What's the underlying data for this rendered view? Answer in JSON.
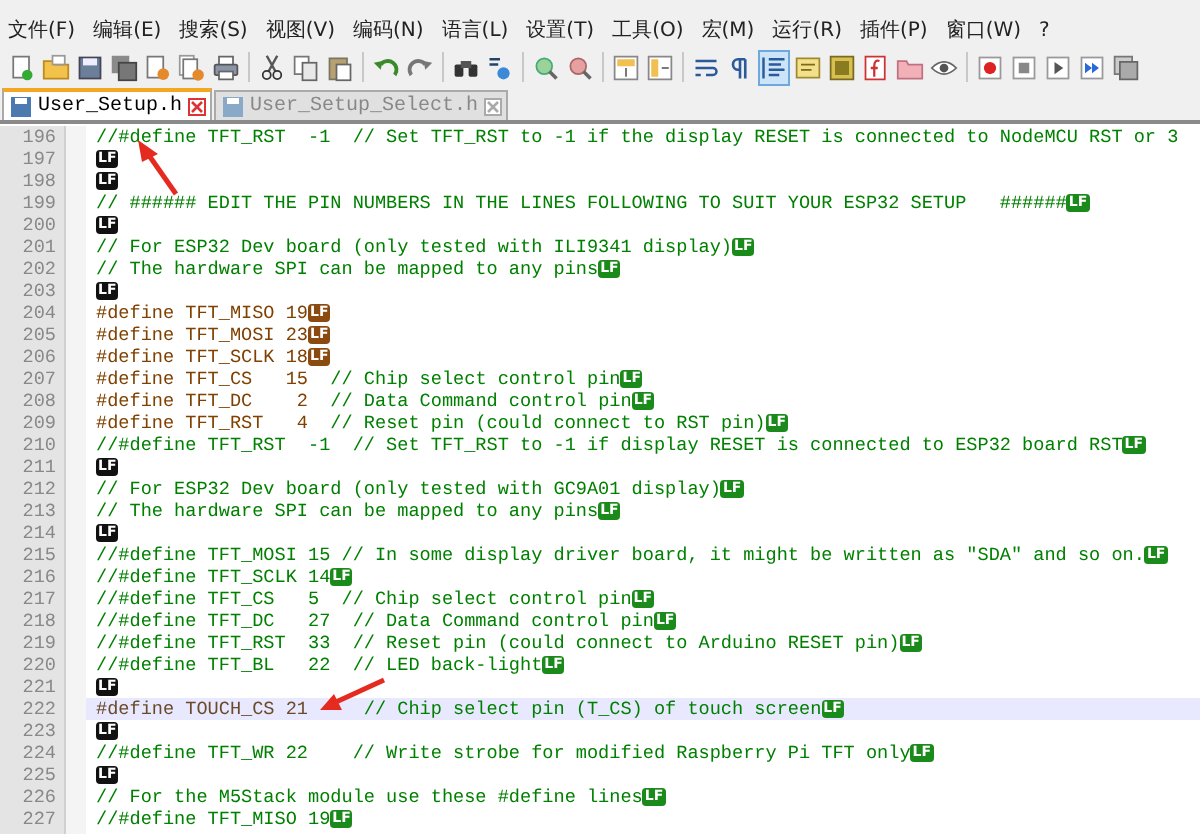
{
  "menu": [
    "文件(F)",
    "编辑(E)",
    "搜索(S)",
    "视图(V)",
    "编码(N)",
    "语言(L)",
    "设置(T)",
    "工具(O)",
    "宏(M)",
    "运行(R)",
    "插件(P)",
    "窗口(W)",
    "?"
  ],
  "toolbar": [
    {
      "kind": "new",
      "pressed": false
    },
    {
      "kind": "open",
      "pressed": false
    },
    {
      "kind": "save",
      "pressed": false
    },
    {
      "kind": "save-all",
      "pressed": false
    },
    {
      "kind": "close",
      "pressed": false
    },
    {
      "kind": "close-all",
      "pressed": false
    },
    {
      "kind": "print",
      "pressed": false
    },
    {
      "kind": "separator"
    },
    {
      "kind": "cut",
      "pressed": false
    },
    {
      "kind": "copy",
      "pressed": false
    },
    {
      "kind": "paste",
      "pressed": false
    },
    {
      "kind": "separator"
    },
    {
      "kind": "undo",
      "pressed": false
    },
    {
      "kind": "redo",
      "pressed": false
    },
    {
      "kind": "separator"
    },
    {
      "kind": "find",
      "pressed": false
    },
    {
      "kind": "replace",
      "pressed": false
    },
    {
      "kind": "separator"
    },
    {
      "kind": "zoom-in",
      "pressed": false
    },
    {
      "kind": "zoom-out",
      "pressed": false
    },
    {
      "kind": "separator"
    },
    {
      "kind": "sync-v",
      "pressed": false
    },
    {
      "kind": "sync-h",
      "pressed": false
    },
    {
      "kind": "separator"
    },
    {
      "kind": "wrap",
      "pressed": false
    },
    {
      "kind": "pilcrow",
      "pressed": false
    },
    {
      "kind": "indent",
      "pressed": true
    },
    {
      "kind": "udl",
      "pressed": false
    },
    {
      "kind": "docmap",
      "pressed": false
    },
    {
      "kind": "function",
      "pressed": false
    },
    {
      "kind": "folder",
      "pressed": false
    },
    {
      "kind": "eye",
      "pressed": false
    },
    {
      "kind": "separator"
    },
    {
      "kind": "record",
      "pressed": false
    },
    {
      "kind": "stop",
      "pressed": false
    },
    {
      "kind": "play",
      "pressed": false
    },
    {
      "kind": "play-multi",
      "pressed": false
    },
    {
      "kind": "save-macro",
      "pressed": false
    }
  ],
  "tabs": [
    {
      "label": "User_Setup.h",
      "selected": true
    },
    {
      "label": "User_Setup_Select.h",
      "selected": false
    }
  ],
  "lines": [
    {
      "number": "196",
      "kind": "comment",
      "text": "//#define TFT_RST  -1  // Set TFT_RST to -1 if the display RESET is connected to NodeMCU RST or 3",
      "current": false
    },
    {
      "number": "197",
      "kind": "blank",
      "eol": "LF",
      "current": false
    },
    {
      "number": "198",
      "kind": "blank",
      "eol": "LF",
      "current": false
    },
    {
      "number": "199",
      "kind": "comment",
      "text": "// ###### EDIT THE PIN NUMBERS IN THE LINES FOLLOWING TO SUIT YOUR ESP32 SETUP   ######",
      "eol": "LF",
      "current": false
    },
    {
      "number": "200",
      "kind": "blank",
      "eol": "LF",
      "current": false
    },
    {
      "number": "201",
      "kind": "comment",
      "text": "// For ESP32 Dev board (only tested with ILI9341 display)",
      "eol": "LF",
      "current": false
    },
    {
      "number": "202",
      "kind": "comment",
      "text": "// The hardware SPI can be mapped to any pins",
      "eol": "LF",
      "current": false
    },
    {
      "number": "203",
      "kind": "blank",
      "eol": "LF",
      "current": false
    },
    {
      "number": "204",
      "kind": "directive",
      "code": "#define TFT_MISO 19",
      "eol": "LF",
      "current": false
    },
    {
      "number": "205",
      "kind": "directive",
      "code": "#define TFT_MOSI 23",
      "eol": "LF",
      "current": false
    },
    {
      "number": "206",
      "kind": "directive",
      "code": "#define TFT_SCLK 18",
      "eol": "LF",
      "current": false
    },
    {
      "number": "207",
      "kind": "directive",
      "code": "#define TFT_CS   15  ",
      "comment": "// Chip select control pin",
      "eol": "LF",
      "current": false
    },
    {
      "number": "208",
      "kind": "directive",
      "code": "#define TFT_DC    2  ",
      "comment": "// Data Command control pin",
      "eol": "LF",
      "current": false
    },
    {
      "number": "209",
      "kind": "directive",
      "code": "#define TFT_RST   4  ",
      "comment": "// Reset pin (could connect to RST pin)",
      "eol": "LF",
      "current": false
    },
    {
      "number": "210",
      "kind": "comment",
      "text": "//#define TFT_RST  -1  // Set TFT_RST to -1 if display RESET is connected to ESP32 board RST",
      "eol": "LF",
      "current": false
    },
    {
      "number": "211",
      "kind": "blank",
      "eol": "LF",
      "current": false
    },
    {
      "number": "212",
      "kind": "comment",
      "text": "// For ESP32 Dev board (only tested with GC9A01 display)",
      "eol": "LF",
      "current": false
    },
    {
      "number": "213",
      "kind": "comment",
      "text": "// The hardware SPI can be mapped to any pins",
      "eol": "LF",
      "current": false
    },
    {
      "number": "214",
      "kind": "blank",
      "eol": "LF",
      "current": false
    },
    {
      "number": "215",
      "kind": "comment",
      "text": "//#define TFT_MOSI 15 // In some display driver board, it might be written as \"SDA\" and so on.",
      "eol": "LF",
      "current": false
    },
    {
      "number": "216",
      "kind": "comment",
      "text": "//#define TFT_SCLK 14",
      "eol": "LF",
      "current": false
    },
    {
      "number": "217",
      "kind": "comment",
      "text": "//#define TFT_CS   5  // Chip select control pin",
      "eol": "LF",
      "current": false
    },
    {
      "number": "218",
      "kind": "comment",
      "text": "//#define TFT_DC   27  // Data Command control pin",
      "eol": "LF",
      "current": false
    },
    {
      "number": "219",
      "kind": "comment",
      "text": "//#define TFT_RST  33  // Reset pin (could connect to Arduino RESET pin)",
      "eol": "LF",
      "current": false
    },
    {
      "number": "220",
      "kind": "comment",
      "text": "//#define TFT_BL   22  // LED back-light",
      "eol": "LF",
      "current": false
    },
    {
      "number": "221",
      "kind": "blank",
      "eol": "LF",
      "current": false
    },
    {
      "number": "222",
      "kind": "directive",
      "code": "#define TOUCH_CS 21     ",
      "comment": "// Chip select pin (T_CS) of touch screen",
      "eol": "LF",
      "current": true
    },
    {
      "number": "223",
      "kind": "blank",
      "eol": "LF",
      "current": false
    },
    {
      "number": "224",
      "kind": "comment",
      "text": "//#define TFT_WR 22    // Write strobe for modified Raspberry Pi TFT only",
      "eol": "LF",
      "current": false
    },
    {
      "number": "225",
      "kind": "blank",
      "eol": "LF",
      "current": false
    },
    {
      "number": "226",
      "kind": "comment",
      "text": "// For the M5Stack module use these #define lines",
      "eol": "LF",
      "current": false
    },
    {
      "number": "227",
      "kind": "comment",
      "text": "//#define TFT_MISO 19",
      "eol": "LF",
      "current": false
    }
  ]
}
